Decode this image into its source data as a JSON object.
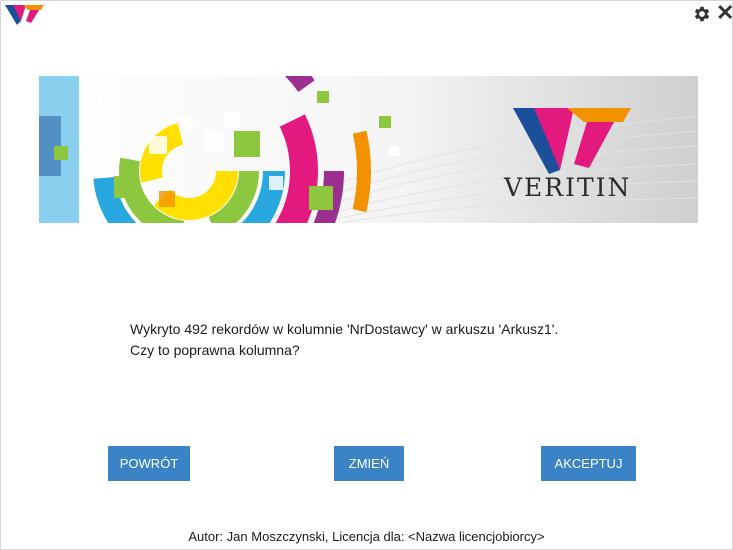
{
  "window": {
    "icons": {
      "logo": "veritin-logo-icon",
      "settings": "gear-icon",
      "close": "close-icon"
    },
    "close_glyph": "✕"
  },
  "banner": {
    "brand_name": "VERITIN",
    "colors": {
      "magenta": "#e4197f",
      "orange": "#f39200",
      "blue": "#1b4f9c",
      "green": "#8dc63f",
      "yellow": "#ffe000",
      "cyan": "#29a8e0"
    }
  },
  "message": {
    "line1": "Wykryto 492 rekordów w kolumnie 'NrDostawcy' w arkuszu 'Arkusz1'.",
    "line2": "Czy to poprawna kolumna?"
  },
  "buttons": {
    "back_label": "POWRÓT",
    "change_label": "ZMIEŃ",
    "accept_label": "AKCEPTUJ",
    "color": "#3b83c7"
  },
  "footer": {
    "text": "Autor: Jan Moszczynski, Licencja dla: <Nazwa licencjobiorcy>"
  }
}
